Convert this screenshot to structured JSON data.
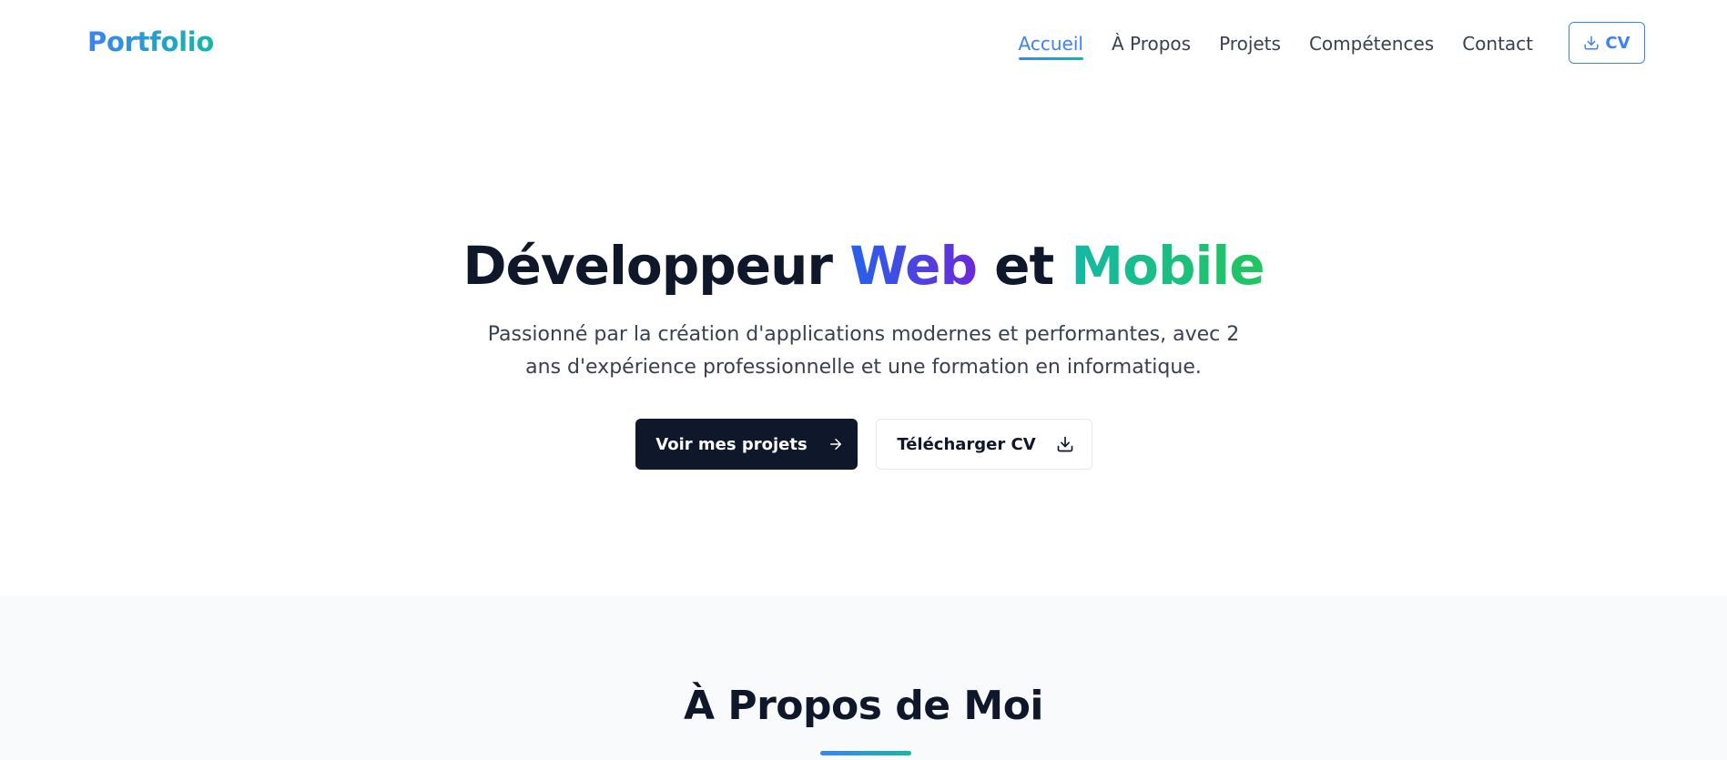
{
  "header": {
    "logo": "Portfolio",
    "nav": [
      {
        "label": "Accueil",
        "active": true
      },
      {
        "label": "À Propos",
        "active": false
      },
      {
        "label": "Projets",
        "active": false
      },
      {
        "label": "Compétences",
        "active": false
      },
      {
        "label": "Contact",
        "active": false
      }
    ],
    "cv_button": {
      "label": "CV",
      "icon": "download-icon"
    }
  },
  "hero": {
    "title": {
      "part1": "Développeur ",
      "part2": "Web",
      "part3": " et ",
      "part4": "Mobile"
    },
    "subtitle": "Passionné par la création d'applications modernes et performantes, avec 2 ans d'expérience professionnelle et une formation en informatique.",
    "primary_button": {
      "label": "Voir mes projets",
      "icon": "arrow-right-icon"
    },
    "secondary_button": {
      "label": "Télécharger CV",
      "icon": "download-icon"
    }
  },
  "about": {
    "title": "À Propos de Moi"
  },
  "colors": {
    "accent_blue": "#3b82f6",
    "accent_teal": "#14b8a6",
    "dark": "#0f172a",
    "section_bg": "#f8fafc"
  }
}
